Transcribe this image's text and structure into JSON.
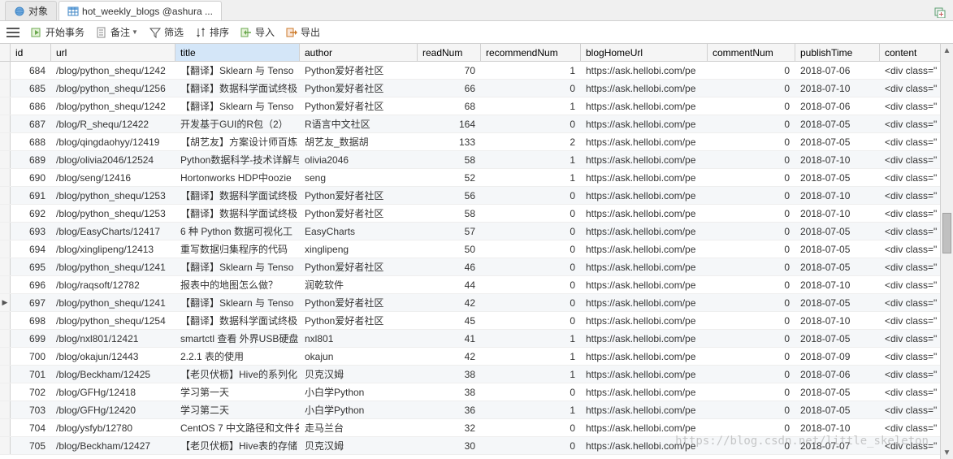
{
  "tabs": [
    {
      "label": "对象",
      "icon": "sphere"
    },
    {
      "label": "hot_weekly_blogs @ashura ...",
      "icon": "table"
    }
  ],
  "toolbar": {
    "begin_tx": "开始事务",
    "memo": "备注",
    "filter": "筛选",
    "sort": "排序",
    "import": "导入",
    "export": "导出"
  },
  "columns": {
    "id": "id",
    "url": "url",
    "title": "title",
    "author": "author",
    "readNum": "readNum",
    "recommendNum": "recommendNum",
    "blogHomeUrl": "blogHomeUrl",
    "commentNum": "commentNum",
    "publishTime": "publishTime",
    "content": "content"
  },
  "rows": [
    {
      "id": 684,
      "url": "/blog/python_shequ/1242",
      "title": "【翻译】Sklearn 与 Tenso",
      "author": "Python爱好者社区",
      "readNum": 70,
      "recommendNum": 1,
      "blogHomeUrl": "https://ask.hellobi.com/pe",
      "commentNum": 0,
      "publishTime": "2018-07-06",
      "content": "<div class=\""
    },
    {
      "id": 685,
      "url": "/blog/python_shequ/1256",
      "title": "【翻译】数据科学面试终极",
      "author": "Python爱好者社区",
      "readNum": 66,
      "recommendNum": 0,
      "blogHomeUrl": "https://ask.hellobi.com/pe",
      "commentNum": 0,
      "publishTime": "2018-07-10",
      "content": "<div class=\""
    },
    {
      "id": 686,
      "url": "/blog/python_shequ/1242",
      "title": "【翻译】Sklearn 与 Tenso",
      "author": "Python爱好者社区",
      "readNum": 68,
      "recommendNum": 1,
      "blogHomeUrl": "https://ask.hellobi.com/pe",
      "commentNum": 0,
      "publishTime": "2018-07-06",
      "content": "<div class=\""
    },
    {
      "id": 687,
      "url": "/blog/R_shequ/12422",
      "title": "开发基于GUI的R包（2）",
      "author": "R语言中文社区",
      "readNum": 164,
      "recommendNum": 0,
      "blogHomeUrl": "https://ask.hellobi.com/pe",
      "commentNum": 0,
      "publishTime": "2018-07-05",
      "content": "<div class=\""
    },
    {
      "id": 688,
      "url": "/blog/qingdaohyy/12419",
      "title": "【胡艺友】方案设计师百炼",
      "author": "胡艺友_数据胡",
      "readNum": 133,
      "recommendNum": 2,
      "blogHomeUrl": "https://ask.hellobi.com/pe",
      "commentNum": 0,
      "publishTime": "2018-07-05",
      "content": "<div class=\""
    },
    {
      "id": 689,
      "url": "/blog/olivia2046/12524",
      "title": "Python数据科学-技术详解与",
      "author": "olivia2046",
      "readNum": 58,
      "recommendNum": 1,
      "blogHomeUrl": "https://ask.hellobi.com/pe",
      "commentNum": 0,
      "publishTime": "2018-07-10",
      "content": "<div class=\""
    },
    {
      "id": 690,
      "url": "/blog/seng/12416",
      "title": "Hortonworks HDP中oozie",
      "author": "seng",
      "readNum": 52,
      "recommendNum": 1,
      "blogHomeUrl": "https://ask.hellobi.com/pe",
      "commentNum": 0,
      "publishTime": "2018-07-05",
      "content": "<div class=\""
    },
    {
      "id": 691,
      "url": "/blog/python_shequ/1253",
      "title": "【翻译】数据科学面试终极",
      "author": "Python爱好者社区",
      "readNum": 56,
      "recommendNum": 0,
      "blogHomeUrl": "https://ask.hellobi.com/pe",
      "commentNum": 0,
      "publishTime": "2018-07-10",
      "content": "<div class=\""
    },
    {
      "id": 692,
      "url": "/blog/python_shequ/1253",
      "title": "【翻译】数据科学面试终极",
      "author": "Python爱好者社区",
      "readNum": 58,
      "recommendNum": 0,
      "blogHomeUrl": "https://ask.hellobi.com/pe",
      "commentNum": 0,
      "publishTime": "2018-07-10",
      "content": "<div class=\""
    },
    {
      "id": 693,
      "url": "/blog/EasyCharts/12417",
      "title": "6 种 Python 数据可视化工",
      "author": "EasyCharts",
      "readNum": 57,
      "recommendNum": 0,
      "blogHomeUrl": "https://ask.hellobi.com/pe",
      "commentNum": 0,
      "publishTime": "2018-07-05",
      "content": "<div class=\""
    },
    {
      "id": 694,
      "url": "/blog/xinglipeng/12413",
      "title": "重写数据归集程序的代码",
      "author": "xinglipeng",
      "readNum": 50,
      "recommendNum": 0,
      "blogHomeUrl": "https://ask.hellobi.com/pe",
      "commentNum": 0,
      "publishTime": "2018-07-05",
      "content": "<div class=\""
    },
    {
      "id": 695,
      "url": "/blog/python_shequ/1241",
      "title": "【翻译】Sklearn 与 Tenso",
      "author": "Python爱好者社区",
      "readNum": 46,
      "recommendNum": 0,
      "blogHomeUrl": "https://ask.hellobi.com/pe",
      "commentNum": 0,
      "publishTime": "2018-07-05",
      "content": "<div class=\""
    },
    {
      "id": 696,
      "url": "/blog/raqsoft/12782",
      "title": "报表中的地图怎么做？",
      "author": "润乾软件",
      "readNum": 44,
      "recommendNum": 0,
      "blogHomeUrl": "https://ask.hellobi.com/pe",
      "commentNum": 0,
      "publishTime": "2018-07-10",
      "content": "<div class=\""
    },
    {
      "id": 697,
      "url": "/blog/python_shequ/1241",
      "title": "【翻译】Sklearn 与 Tenso",
      "author": "Python爱好者社区",
      "readNum": 42,
      "recommendNum": 0,
      "blogHomeUrl": "https://ask.hellobi.com/pe",
      "commentNum": 0,
      "publishTime": "2018-07-05",
      "content": "<div class=\""
    },
    {
      "id": 698,
      "url": "/blog/python_shequ/1254",
      "title": "【翻译】数据科学面试终极",
      "author": "Python爱好者社区",
      "readNum": 45,
      "recommendNum": 0,
      "blogHomeUrl": "https://ask.hellobi.com/pe",
      "commentNum": 0,
      "publishTime": "2018-07-10",
      "content": "<div class=\""
    },
    {
      "id": 699,
      "url": "/blog/nxl801/12421",
      "title": "smartctl 查看 外界USB硬盘",
      "author": "nxl801",
      "readNum": 41,
      "recommendNum": 1,
      "blogHomeUrl": "https://ask.hellobi.com/pe",
      "commentNum": 0,
      "publishTime": "2018-07-05",
      "content": "<div class=\""
    },
    {
      "id": 700,
      "url": "/blog/okajun/12443",
      "title": "2.2.1 表的使用",
      "author": "okajun",
      "readNum": 42,
      "recommendNum": 1,
      "blogHomeUrl": "https://ask.hellobi.com/pe",
      "commentNum": 0,
      "publishTime": "2018-07-09",
      "content": "<div class=\""
    },
    {
      "id": 701,
      "url": "/blog/Beckham/12425",
      "title": "【老贝伏枥】Hive的系列化",
      "author": "贝克汉姆",
      "readNum": 38,
      "recommendNum": 1,
      "blogHomeUrl": "https://ask.hellobi.com/pe",
      "commentNum": 0,
      "publishTime": "2018-07-06",
      "content": "<div class=\""
    },
    {
      "id": 702,
      "url": "/blog/GFHg/12418",
      "title": "学习第一天",
      "author": "小白学Python",
      "readNum": 38,
      "recommendNum": 0,
      "blogHomeUrl": "https://ask.hellobi.com/pe",
      "commentNum": 0,
      "publishTime": "2018-07-05",
      "content": "<div class=\""
    },
    {
      "id": 703,
      "url": "/blog/GFHg/12420",
      "title": "学习第二天",
      "author": "小白学Python",
      "readNum": 36,
      "recommendNum": 1,
      "blogHomeUrl": "https://ask.hellobi.com/pe",
      "commentNum": 0,
      "publishTime": "2018-07-05",
      "content": "<div class=\""
    },
    {
      "id": 704,
      "url": "/blog/ysfyb/12780",
      "title": "CentOS 7 中文路径和文件名",
      "author": "走马兰台",
      "readNum": 32,
      "recommendNum": 0,
      "blogHomeUrl": "https://ask.hellobi.com/pe",
      "commentNum": 0,
      "publishTime": "2018-07-10",
      "content": "<div class=\""
    },
    {
      "id": 705,
      "url": "/blog/Beckham/12427",
      "title": "【老贝伏枥】Hive表的存储",
      "author": "贝克汉姆",
      "readNum": 30,
      "recommendNum": 0,
      "blogHomeUrl": "https://ask.hellobi.com/pe",
      "commentNum": 0,
      "publishTime": "2018-07-07",
      "content": "<div class=\""
    }
  ],
  "current_row_index": 13,
  "watermark": "https://blog.csdn.net/little_skeleton"
}
